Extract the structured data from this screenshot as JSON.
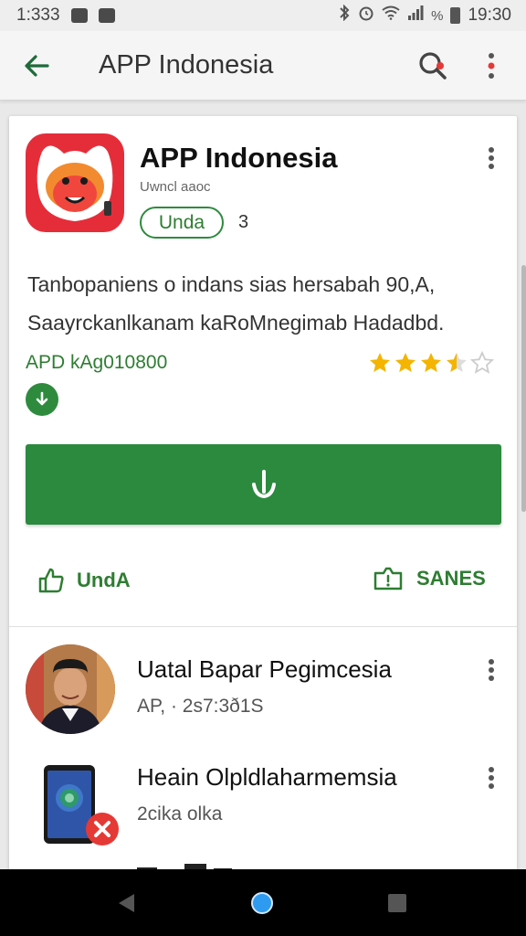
{
  "status_bar": {
    "time_left": "1:333",
    "time_right": "19:30",
    "battery_label": "%"
  },
  "app_bar": {
    "title": "APP Indonesia",
    "back_icon": "arrow-back-icon",
    "search_icon": "search-icon",
    "overflow_icon": "overflow-menu-icon"
  },
  "app_card": {
    "title": "APP Indonesia",
    "subtitle": "Uwncl aaoc",
    "pill_label": "Unda",
    "pill_count": "3",
    "description_line1": "Tanbopaniens o indans sias hersabah 90,A,",
    "description_line2": "Saayrckanlkanam kaRoMnegimab Hadadbd.",
    "developer": "APD kAg010800",
    "rating_stars": 3.5,
    "rating_max": 5,
    "install_icon": "download-icon",
    "action_left_label": "UndA",
    "action_left_icon": "share-icon",
    "action_right_label": "SANES",
    "action_right_icon": "alert-icon"
  },
  "related": [
    {
      "title": "Uatal Bapar Pegimcesia",
      "subtitle": "AP, · 2s7:3ð1S"
    },
    {
      "title": "Heain Olpldlaharmemsia",
      "subtitle": "2cika olka"
    }
  ],
  "colors": {
    "accent_green": "#2b8a3e",
    "app_icon_red": "#e52d3a",
    "star_yellow": "#f4b400",
    "alert_red": "#e53935"
  }
}
